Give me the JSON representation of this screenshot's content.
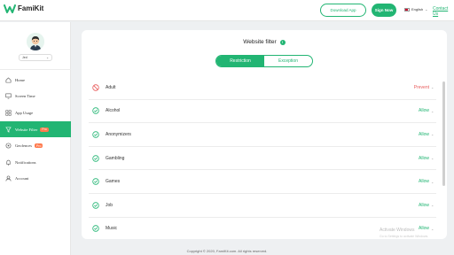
{
  "brand": {
    "name": "FamiKit",
    "color": "#22b573"
  },
  "header": {
    "download_label": "Download App",
    "signup_label": "Sign Now",
    "language": "English",
    "contact_label": "Contact Us"
  },
  "sidebar": {
    "user": "Jed",
    "items": [
      {
        "label": "Home",
        "icon": "home-icon"
      },
      {
        "label": "Screen Time",
        "icon": "screen-time-icon"
      },
      {
        "label": "App Usage",
        "icon": "app-usage-icon"
      },
      {
        "label": "Website Filter",
        "icon": "filter-icon",
        "badge": "Pro",
        "active": true
      },
      {
        "label": "Geofences",
        "icon": "geofence-icon",
        "badge": "Pro"
      },
      {
        "label": "Notifications",
        "icon": "bell-icon"
      },
      {
        "label": "Account",
        "icon": "user-icon"
      }
    ]
  },
  "main": {
    "title": "Website filter",
    "tabs": [
      {
        "label": "Restriction",
        "active": true
      },
      {
        "label": "Exception",
        "active": false
      }
    ],
    "rows": [
      {
        "name": "Adult",
        "status": "Prevent",
        "state": "prevent"
      },
      {
        "name": "Alcohol",
        "status": "Allow",
        "state": "allow"
      },
      {
        "name": "Anonymizers",
        "status": "Allow",
        "state": "allow"
      },
      {
        "name": "Gambling",
        "status": "Allow",
        "state": "allow"
      },
      {
        "name": "Games",
        "status": "Allow",
        "state": "allow"
      },
      {
        "name": "Job",
        "status": "Allow",
        "state": "allow"
      },
      {
        "name": "Music",
        "status": "Allow",
        "state": "allow"
      }
    ]
  },
  "footer": {
    "copyright": "Copyright © 2020, FamiKit.com. All rights reserved."
  },
  "watermark": {
    "line1": "Activate Windows",
    "line2": "Go to Settings to activate Windows."
  },
  "colors": {
    "accent": "#22b573",
    "prevent": "#e85a5a",
    "badge": "#ff7a4d"
  }
}
